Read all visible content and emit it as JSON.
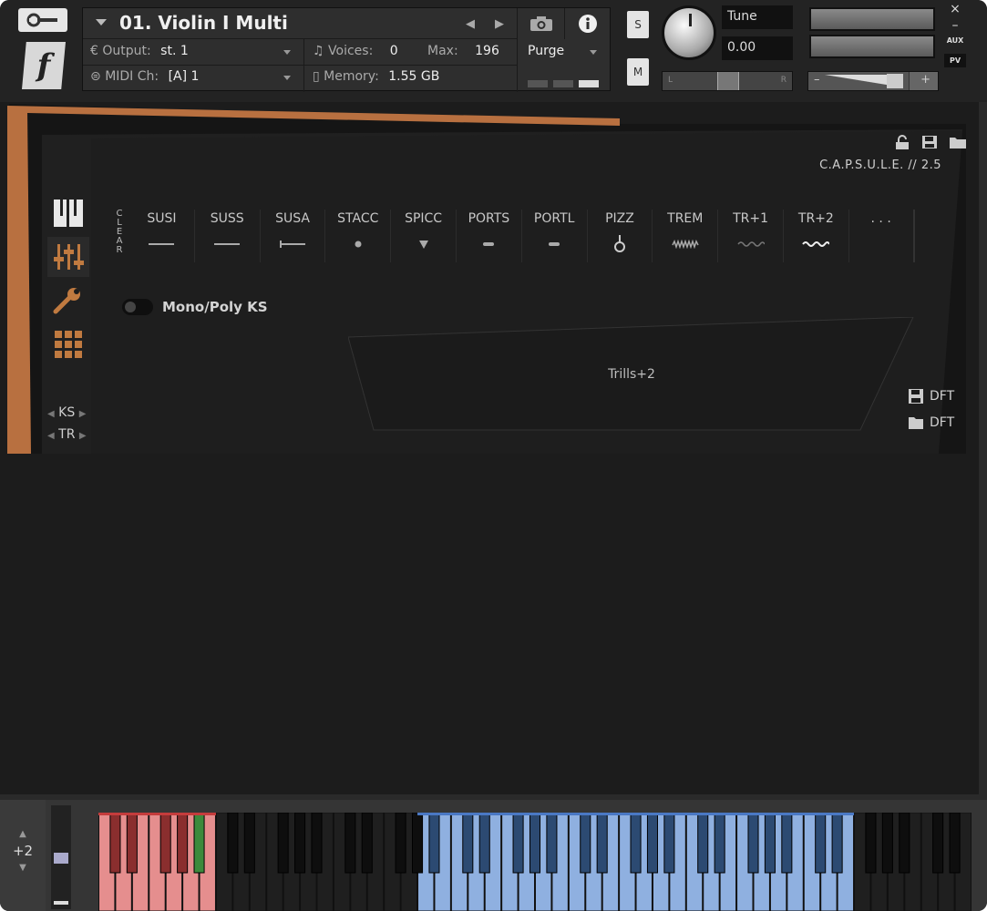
{
  "header": {
    "instrument_title": "01. Violin I Multi",
    "output_label": "Output:",
    "output_value": "st. 1",
    "voices_label": "Voices:",
    "voices_value": "0",
    "max_label": "Max:",
    "max_value": "196",
    "purge_label": "Purge",
    "midi_label": "MIDI Ch:",
    "midi_value": "[A]  1",
    "memory_label": "Memory:",
    "memory_value": "1.55 GB",
    "solo_label": "S",
    "mute_label": "M",
    "tune_label": "Tune",
    "tune_value": "0.00",
    "pan_left": "L",
    "pan_right": "R",
    "vol_minus": "–",
    "vol_plus": "+",
    "side_close": "×",
    "side_min": "–",
    "side_aux": "AUX",
    "side_pv": "PV"
  },
  "panel": {
    "capsule_label": "C.A.P.S.U.L.E. // 2.5",
    "clear_label": "CLEAR",
    "articulations": [
      {
        "label": "SUSI",
        "icon": "line"
      },
      {
        "label": "SUSS",
        "icon": "line"
      },
      {
        "label": "SUSA",
        "icon": "accent-line"
      },
      {
        "label": "STACC",
        "icon": "dot"
      },
      {
        "label": "SPICC",
        "icon": "wedge"
      },
      {
        "label": "PORTS",
        "icon": "dash"
      },
      {
        "label": "PORTL",
        "icon": "dash"
      },
      {
        "label": "PIZZ",
        "icon": "pizz"
      },
      {
        "label": "TREM",
        "icon": "trem"
      },
      {
        "label": "TR+1",
        "icon": "trill-faint"
      },
      {
        "label": "TR+2",
        "icon": "trill"
      },
      {
        "label": ". . .",
        "icon": "none"
      }
    ],
    "mono_poly_label": "Mono/Poly KS",
    "display_text": "Trills+2",
    "ks_label": "KS",
    "tr_label": "TR",
    "dft_save_label": "DFT",
    "dft_load_label": "DFT"
  },
  "keyboard": {
    "octave_shift": "+2"
  },
  "colors": {
    "accent_orange": "#c07a40",
    "keyswitch_red": "#e58e8e",
    "keyswitch_active_green": "#3c8a3c",
    "playable_blue": "#8fb0e0"
  }
}
